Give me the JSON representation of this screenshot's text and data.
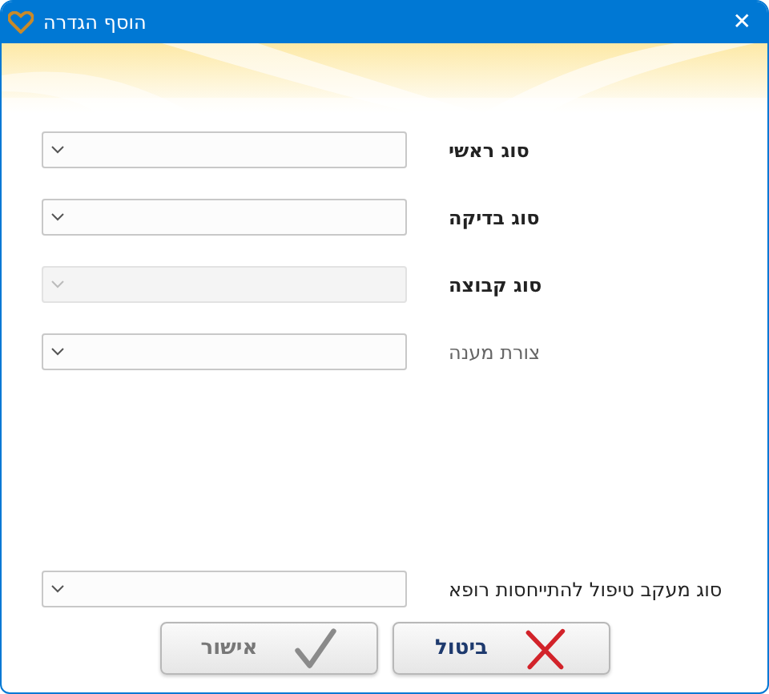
{
  "window": {
    "title": "הוסף הגדרה",
    "close": "✕"
  },
  "fields": [
    {
      "label": "סוג ראשי",
      "bold": true,
      "dimmed": false,
      "disabled": false
    },
    {
      "label": "סוג בדיקה",
      "bold": true,
      "dimmed": false,
      "disabled": false
    },
    {
      "label": "סוג קבוצה",
      "bold": true,
      "dimmed": false,
      "disabled": true
    },
    {
      "label": "צורת מענה",
      "bold": false,
      "dimmed": true,
      "disabled": false
    },
    {
      "label": "סוג מעקב טיפול להתייחסות רופא",
      "bold": false,
      "dimmed": false,
      "disabled": false
    }
  ],
  "buttons": [
    {
      "label": "ביטול",
      "kind": "cancel",
      "disabled": false
    },
    {
      "label": "אישור",
      "kind": "ok",
      "disabled": true
    }
  ]
}
